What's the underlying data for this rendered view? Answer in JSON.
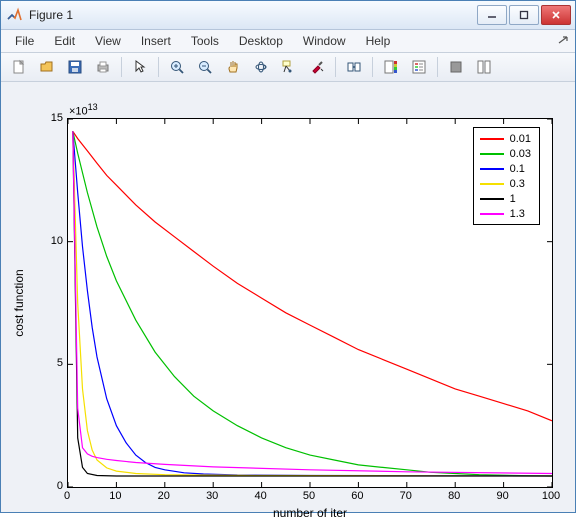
{
  "window": {
    "title": "Figure 1"
  },
  "menubar": {
    "items": [
      "File",
      "Edit",
      "View",
      "Insert",
      "Tools",
      "Desktop",
      "Window",
      "Help"
    ]
  },
  "toolbar_icons": [
    "new",
    "open",
    "save",
    "print",
    "sep",
    "pointer",
    "sep",
    "zoom-in",
    "zoom-out",
    "pan",
    "rotate",
    "data-cursor",
    "brush",
    "sep",
    "link",
    "sep",
    "colorbar",
    "legend",
    "sep",
    "hide",
    "show-plot-tools"
  ],
  "chart_data": {
    "type": "line",
    "title": "",
    "xlabel": "number of iter",
    "ylabel": "cost function",
    "xlim": [
      0,
      100
    ],
    "ylim": [
      0,
      15
    ],
    "y_scale_exponent": 13,
    "y_scale_label": "×10",
    "xticks": [
      0,
      10,
      20,
      30,
      40,
      50,
      60,
      70,
      80,
      90,
      100
    ],
    "yticks": [
      0,
      5,
      10,
      15
    ],
    "legend_position": "upper-right",
    "series": [
      {
        "name": "0.01",
        "color": "#ff0000",
        "x": [
          1,
          2,
          4,
          6,
          8,
          10,
          14,
          18,
          22,
          26,
          30,
          35,
          40,
          45,
          50,
          55,
          60,
          65,
          70,
          75,
          80,
          85,
          90,
          95,
          100
        ],
        "y": [
          14.5,
          14.2,
          13.7,
          13.2,
          12.7,
          12.3,
          11.5,
          10.8,
          10.2,
          9.6,
          9.0,
          8.3,
          7.7,
          7.1,
          6.6,
          6.1,
          5.6,
          5.2,
          4.8,
          4.4,
          4.0,
          3.7,
          3.4,
          3.1,
          2.7
        ]
      },
      {
        "name": "0.03",
        "color": "#00c000",
        "x": [
          1,
          2,
          4,
          6,
          8,
          10,
          14,
          18,
          22,
          26,
          30,
          35,
          40,
          45,
          50,
          55,
          60,
          65,
          70,
          75,
          80,
          85,
          90,
          95,
          100
        ],
        "y": [
          14.5,
          13.6,
          12.0,
          10.6,
          9.4,
          8.4,
          6.8,
          5.5,
          4.5,
          3.7,
          3.1,
          2.5,
          2.0,
          1.6,
          1.3,
          1.1,
          0.9,
          0.8,
          0.7,
          0.6,
          0.55,
          0.5,
          0.48,
          0.46,
          0.45
        ]
      },
      {
        "name": "0.1",
        "color": "#0000ff",
        "x": [
          1,
          2,
          3,
          4,
          5,
          6,
          8,
          10,
          12,
          14,
          16,
          18,
          20,
          24,
          28,
          35,
          50,
          70,
          100
        ],
        "y": [
          14.5,
          12.0,
          9.8,
          8.0,
          6.5,
          5.3,
          3.6,
          2.5,
          1.8,
          1.3,
          1.0,
          0.8,
          0.7,
          0.58,
          0.53,
          0.49,
          0.47,
          0.46,
          0.45
        ]
      },
      {
        "name": "0.3",
        "color": "#f5e000",
        "x": [
          1,
          2,
          3,
          4,
          5,
          6,
          8,
          10,
          14,
          20,
          40,
          100
        ],
        "y": [
          14.5,
          7.5,
          4.0,
          2.3,
          1.5,
          1.1,
          0.78,
          0.65,
          0.55,
          0.5,
          0.47,
          0.45
        ]
      },
      {
        "name": "1",
        "color": "#000000",
        "x": [
          1,
          2,
          3,
          4,
          6,
          10,
          20,
          100
        ],
        "y": [
          14.5,
          2.0,
          0.8,
          0.55,
          0.47,
          0.45,
          0.45,
          0.45
        ]
      },
      {
        "name": "1.3",
        "color": "#ff00ff",
        "x": [
          1,
          2,
          3,
          4,
          5,
          6,
          8,
          10,
          14,
          20,
          30,
          50,
          70,
          100
        ],
        "y": [
          14.5,
          3.2,
          1.6,
          1.35,
          1.25,
          1.2,
          1.13,
          1.08,
          1.0,
          0.92,
          0.82,
          0.7,
          0.62,
          0.55
        ]
      }
    ]
  }
}
